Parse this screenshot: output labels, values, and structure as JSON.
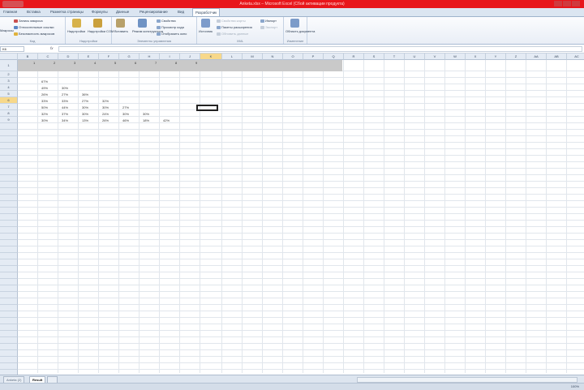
{
  "window": {
    "title": "Anketa.xlsx – Microsoft Excel (Сбой активации продукта)"
  },
  "ribbon_tabs": [
    "Главная",
    "Вставка",
    "Разметка страницы",
    "Формулы",
    "Данные",
    "Рецензирование",
    "Вид",
    "Разработчик"
  ],
  "active_tab": "Разработчик",
  "ribbon": {
    "code": {
      "label": "Код",
      "macros": "Макросы",
      "record": "Запись макроса",
      "relative": "Относительные ссылки",
      "security": "Безопасность макросов"
    },
    "addins": {
      "label": "Надстройки",
      "addins": "Надстройки",
      "com": "Надстройки COM"
    },
    "controls": {
      "label": "Элементы управления",
      "insert": "Вставить",
      "design": "Режим конструктора",
      "properties": "Свойства",
      "view_code": "Просмотр кода",
      "dialog": "Отобразить окно"
    },
    "xml": {
      "label": "XML",
      "source": "Источник",
      "map_props": "Свойства карты",
      "packs": "Пакеты расширения",
      "refresh": "Обновить данные",
      "import": "Импорт",
      "export": "Экспорт"
    },
    "modify": {
      "label": "Изменение",
      "doc_panel": "Область документа"
    }
  },
  "formula_bar": {
    "name_box": "K6",
    "fx": "fx",
    "formula": ""
  },
  "columns": [
    "B",
    "C",
    "D",
    "E",
    "F",
    "G",
    "H",
    "I",
    "J",
    "K",
    "L",
    "M",
    "N",
    "O",
    "P",
    "Q",
    "R",
    "S",
    "T",
    "U",
    "V",
    "W",
    "X",
    "Y",
    "Z",
    "AA",
    "AB",
    "AC"
  ],
  "rows": [
    "1",
    "2",
    "3",
    "4",
    "5",
    "6",
    "7",
    "8",
    "9"
  ],
  "header_row": [
    "1",
    "2",
    "3",
    "4",
    "5",
    "6",
    "7",
    "8",
    "9"
  ],
  "table": [
    [
      "67%"
    ],
    [
      "49%",
      "30%"
    ],
    [
      "26%",
      "27%",
      "36%"
    ],
    [
      "33%",
      "33%",
      "27%",
      "32%"
    ],
    [
      "50%",
      "44%",
      "30%",
      "30%",
      "27%"
    ],
    [
      "32%",
      "37%",
      "30%",
      "24%",
      "30%",
      "30%"
    ],
    [
      "30%",
      "34%",
      "13%",
      "26%",
      "46%",
      "18%",
      "42%"
    ]
  ],
  "sheets": [
    "Anketa (2)",
    "Result"
  ],
  "active_sheet": "Result",
  "status": {
    "zoom": "100%"
  }
}
